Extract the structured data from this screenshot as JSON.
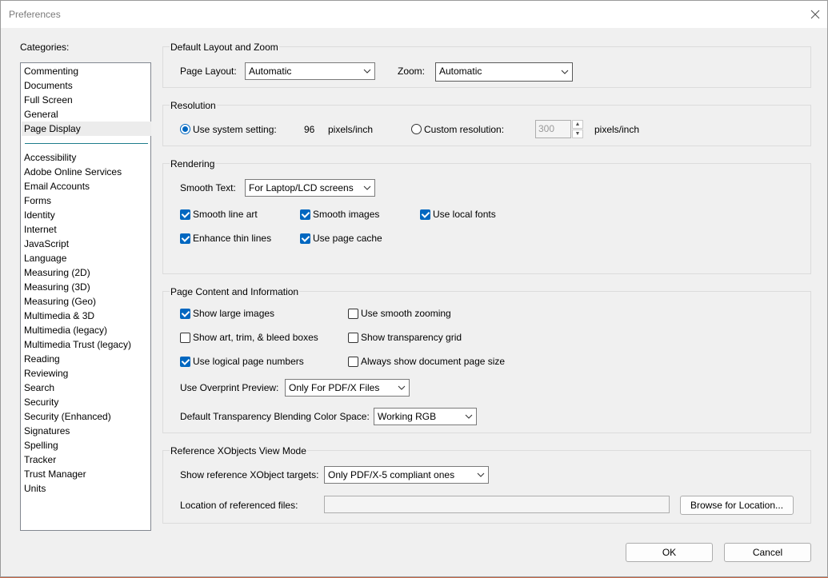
{
  "window": {
    "title": "Preferences"
  },
  "categories": {
    "label": "Categories:",
    "top_items": [
      "Commenting",
      "Documents",
      "Full Screen",
      "General",
      "Page Display"
    ],
    "selected": "Page Display",
    "bottom_items": [
      "Accessibility",
      "Adobe Online Services",
      "Email Accounts",
      "Forms",
      "Identity",
      "Internet",
      "JavaScript",
      "Language",
      "Measuring (2D)",
      "Measuring (3D)",
      "Measuring (Geo)",
      "Multimedia & 3D",
      "Multimedia (legacy)",
      "Multimedia Trust (legacy)",
      "Reading",
      "Reviewing",
      "Search",
      "Security",
      "Security (Enhanced)",
      "Signatures",
      "Spelling",
      "Tracker",
      "Trust Manager",
      "Units"
    ]
  },
  "layout_zoom": {
    "title": "Default Layout and Zoom",
    "page_layout_label": "Page Layout:",
    "page_layout_value": "Automatic",
    "zoom_label": "Zoom:",
    "zoom_value": "Automatic"
  },
  "resolution": {
    "title": "Resolution",
    "use_system_label": "Use system setting:",
    "system_value": "96",
    "system_unit": "pixels/inch",
    "custom_label": "Custom resolution:",
    "custom_value": "300",
    "custom_unit": "pixels/inch",
    "use_system_selected": true
  },
  "rendering": {
    "title": "Rendering",
    "smooth_text_label": "Smooth Text:",
    "smooth_text_value": "For Laptop/LCD screens",
    "smooth_line_art": "Smooth line art",
    "smooth_images": "Smooth images",
    "use_local_fonts": "Use local fonts",
    "enhance_thin_lines": "Enhance thin lines",
    "use_page_cache": "Use page cache"
  },
  "page_content": {
    "title": "Page Content and Information",
    "show_large_images": "Show large images",
    "use_smooth_zooming": "Use smooth zooming",
    "show_art_trim_bleed": "Show art, trim, & bleed boxes",
    "show_transparency_grid": "Show transparency grid",
    "use_logical_page_numbers": "Use logical page numbers",
    "always_show_page_size": "Always show document page size",
    "overprint_label": "Use Overprint Preview:",
    "overprint_value": "Only For PDF/X Files",
    "blending_label": "Default Transparency Blending Color Space:",
    "blending_value": "Working RGB"
  },
  "xobjects": {
    "title": "Reference XObjects View Mode",
    "targets_label": "Show reference XObject targets:",
    "targets_value": "Only PDF/X-5 compliant ones",
    "location_label": "Location of referenced files:",
    "location_value": "",
    "browse_label": "Browse for Location..."
  },
  "footer": {
    "ok_label": "OK",
    "cancel_label": "Cancel"
  },
  "colors": {
    "accent": "#0067c0",
    "separator": "#1e7d8c"
  }
}
